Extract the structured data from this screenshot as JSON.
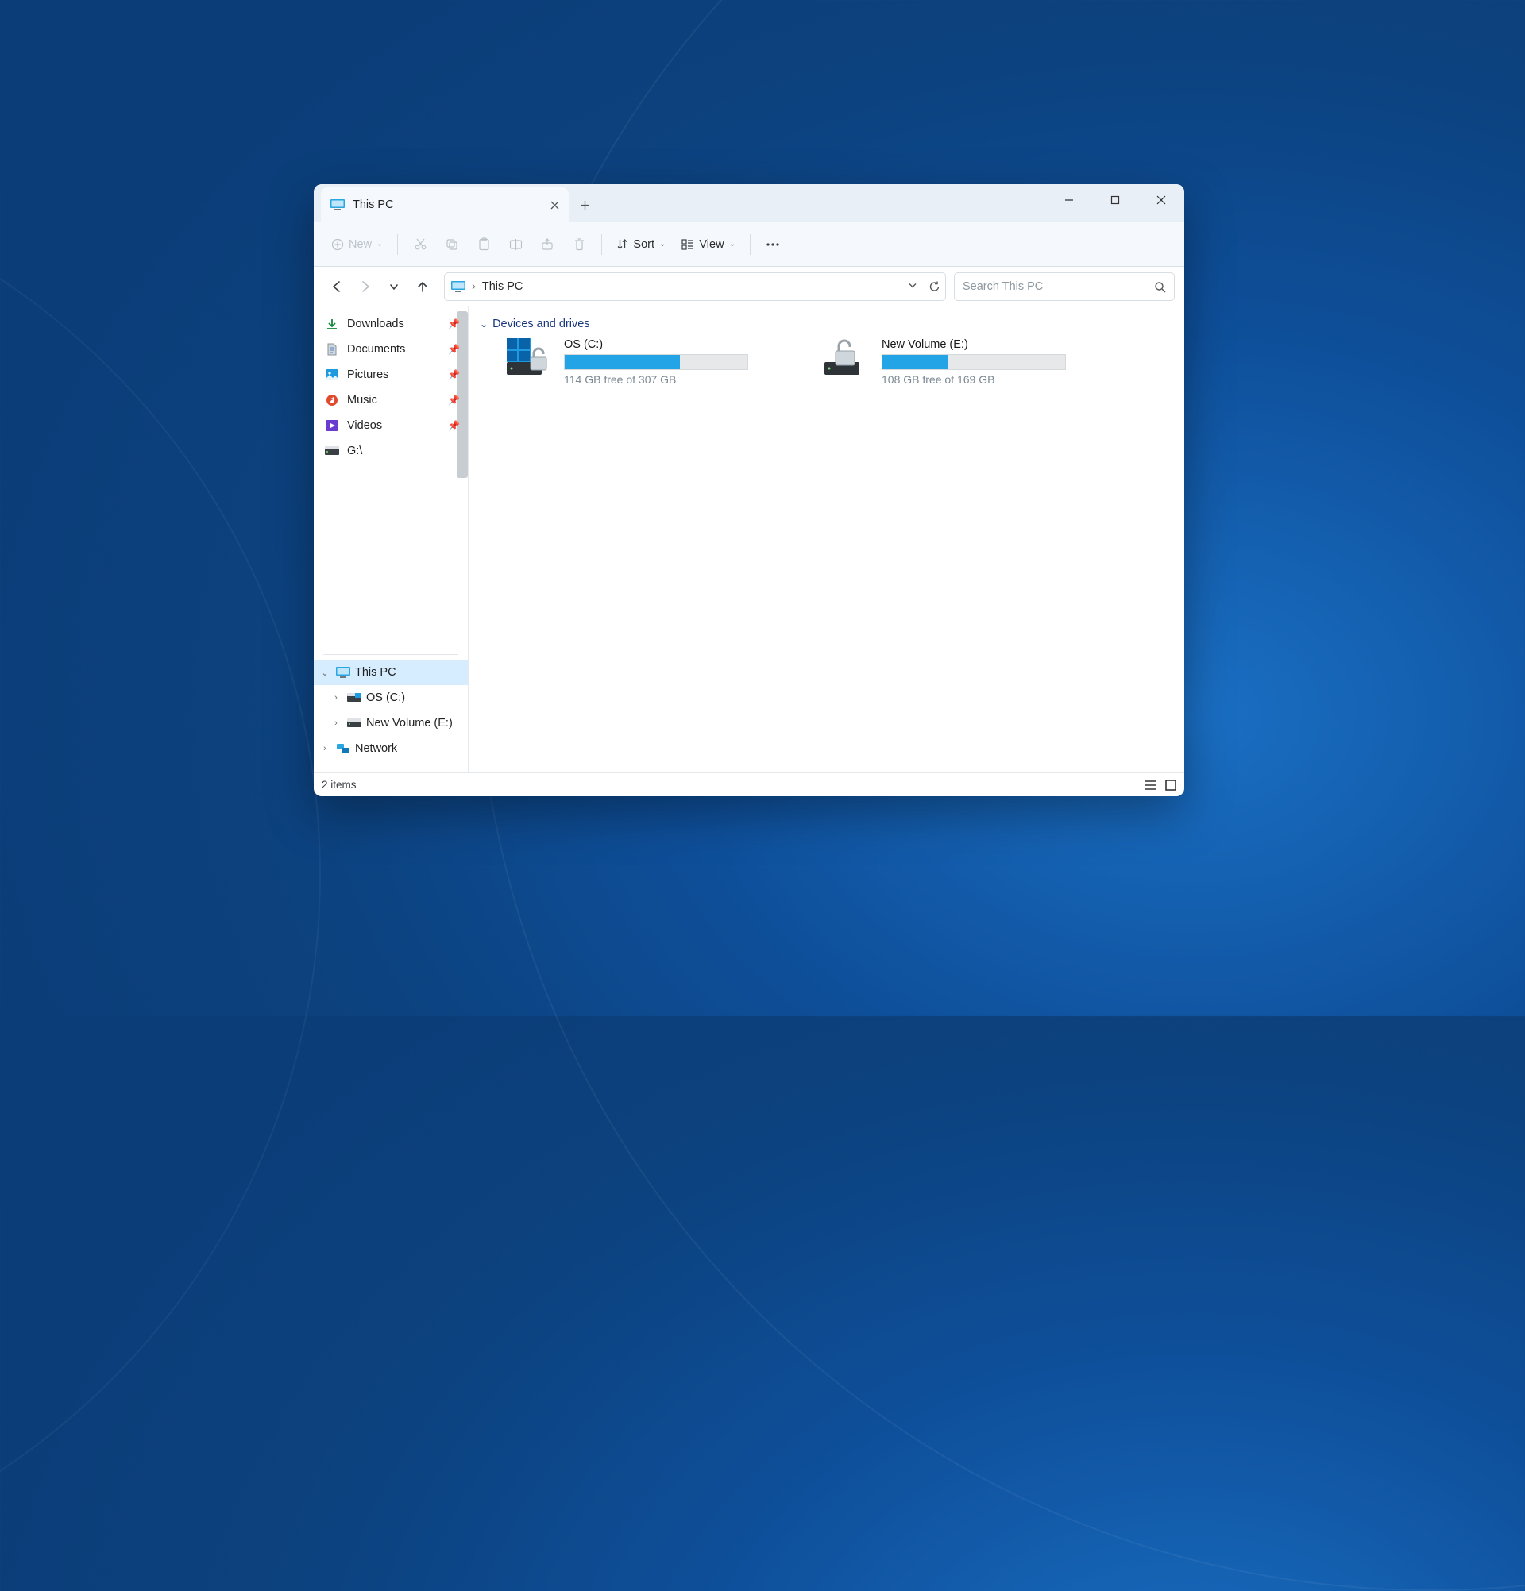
{
  "tab": {
    "title": "This PC"
  },
  "toolbar": {
    "new_label": "New",
    "sort_label": "Sort",
    "view_label": "View"
  },
  "address": {
    "location": "This PC",
    "separator": "›"
  },
  "search": {
    "placeholder": "Search This PC"
  },
  "sidebar": {
    "quick": [
      {
        "label": "Downloads",
        "icon": "download"
      },
      {
        "label": "Documents",
        "icon": "document"
      },
      {
        "label": "Pictures",
        "icon": "pictures"
      },
      {
        "label": "Music",
        "icon": "music"
      },
      {
        "label": "Videos",
        "icon": "videos"
      },
      {
        "label": "G:\\",
        "icon": "drive"
      }
    ],
    "tree": {
      "this_pc": "This PC",
      "os": "OS (C:)",
      "vol_e": "New Volume (E:)",
      "network": "Network"
    }
  },
  "content": {
    "group_header": "Devices and drives",
    "drives": [
      {
        "name": "OS (C:)",
        "free_text": "114 GB free of 307 GB",
        "used_pct": 63
      },
      {
        "name": "New Volume (E:)",
        "free_text": "108 GB free of 169 GB",
        "used_pct": 36
      }
    ]
  },
  "status": {
    "item_count": "2 items"
  }
}
